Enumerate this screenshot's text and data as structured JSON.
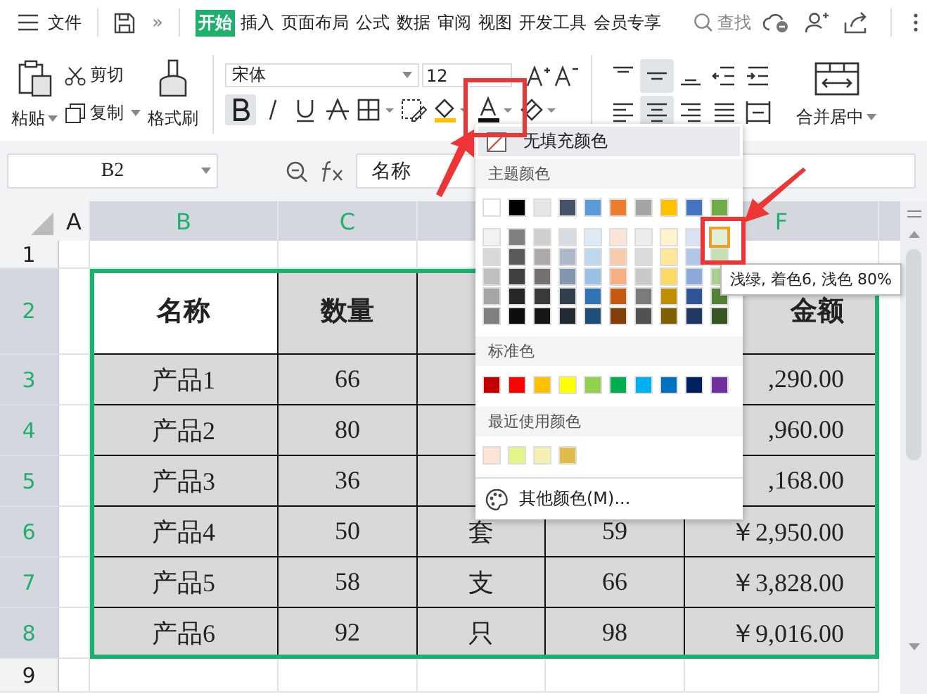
{
  "menu": {
    "file": "文件",
    "more": "»",
    "tabs": [
      {
        "label": "开始",
        "selected": true
      },
      {
        "label": "插入",
        "selected": false
      },
      {
        "label": "页面布局",
        "selected": false
      },
      {
        "label": "公式",
        "selected": false
      },
      {
        "label": "数据",
        "selected": false
      },
      {
        "label": "审阅",
        "selected": false
      },
      {
        "label": "视图",
        "selected": false
      },
      {
        "label": "开发工具",
        "selected": false
      },
      {
        "label": "会员专享",
        "selected": false
      }
    ],
    "search": "查找"
  },
  "ribbon": {
    "paste": "粘贴",
    "cut": "剪切",
    "copy": "复制",
    "format_painter": "格式刷",
    "font_name": "宋体",
    "font_size": "12",
    "bold": {
      "on": true
    },
    "italic": {
      "on": false
    },
    "underline": {
      "on": false
    },
    "align_rows": [
      [
        {
          "kind": "top",
          "selected": false
        },
        {
          "kind": "middle",
          "selected": true
        },
        {
          "kind": "bottom",
          "selected": false
        },
        {
          "kind": "outdent",
          "selected": false
        },
        {
          "kind": "indent",
          "selected": false
        }
      ],
      [
        {
          "kind": "left",
          "selected": false
        },
        {
          "kind": "center",
          "selected": true
        },
        {
          "kind": "right",
          "selected": false
        },
        {
          "kind": "justify",
          "selected": false
        },
        {
          "kind": "distribute",
          "selected": false
        }
      ]
    ],
    "merge": "合并居中"
  },
  "formula_bar": {
    "name_box": "B2",
    "formula": "名称"
  },
  "sheet": {
    "columns": [
      {
        "label": "A",
        "selected": false
      },
      {
        "label": "B",
        "selected": true
      },
      {
        "label": "C",
        "selected": true
      },
      {},
      {},
      {
        "label": "F",
        "selected": true
      }
    ],
    "rows": [
      {
        "label": "1",
        "selected": false,
        "kind": "blank"
      },
      {
        "label": "2",
        "selected": true,
        "kind": "header",
        "cells": [
          {},
          {
            "text": "名称",
            "active": true
          },
          {
            "text": "数量",
            "active": false
          },
          {},
          {},
          {
            "text": "金额",
            "active": false
          }
        ]
      },
      {
        "label": "3",
        "selected": true,
        "kind": "data",
        "cells": [
          {},
          {
            "text": "产品1",
            "active": false
          },
          {
            "text": "66",
            "active": false
          },
          {},
          {},
          {
            "text": ",290.00",
            "active": false
          }
        ]
      },
      {
        "label": "4",
        "selected": true,
        "kind": "data",
        "cells": [
          {},
          {
            "text": "产品2",
            "active": false
          },
          {
            "text": "80",
            "active": false
          },
          {},
          {},
          {
            "text": ",960.00",
            "active": false
          }
        ]
      },
      {
        "label": "5",
        "selected": true,
        "kind": "data",
        "cells": [
          {},
          {
            "text": "产品3",
            "active": false
          },
          {
            "text": "36",
            "active": false
          },
          {},
          {},
          {
            "text": ",168.00",
            "active": false
          }
        ]
      },
      {
        "label": "6",
        "selected": true,
        "kind": "data",
        "cells": [
          {},
          {
            "text": "产品4",
            "active": false
          },
          {
            "text": "50",
            "active": false
          },
          {
            "text": "套",
            "active": false
          },
          {
            "text": "59",
            "active": false
          },
          {
            "text": "￥2,950.00",
            "active": false
          }
        ]
      },
      {
        "label": "7",
        "selected": true,
        "kind": "data",
        "cells": [
          {},
          {
            "text": "产品5",
            "active": false
          },
          {
            "text": "58",
            "active": false
          },
          {
            "text": "支",
            "active": false
          },
          {
            "text": "66",
            "active": false
          },
          {
            "text": "￥3,828.00",
            "active": false
          }
        ]
      },
      {
        "label": "8",
        "selected": true,
        "kind": "data",
        "cells": [
          {},
          {
            "text": "产品6",
            "active": false
          },
          {
            "text": "92",
            "active": false
          },
          {
            "text": "只",
            "active": false
          },
          {
            "text": "98",
            "active": false
          },
          {
            "text": "￥9,016.00",
            "active": false
          }
        ]
      },
      {
        "label": "9",
        "selected": false,
        "kind": "blank"
      }
    ]
  },
  "fill_menu": {
    "no_fill": {
      "label": "无填充颜色",
      "highlighted": true
    },
    "theme_label": "主题颜色",
    "theme_colors": [
      {
        "color": "#ffffff",
        "selected": false,
        "shades": [
          {
            "color": "#f2f2f2",
            "selected": false
          },
          {
            "color": "#d9d9d9",
            "selected": false
          },
          {
            "color": "#bfbfbf",
            "selected": false
          },
          {
            "color": "#a6a6a6",
            "selected": false
          },
          {
            "color": "#808080",
            "selected": false
          }
        ]
      },
      {
        "color": "#000000",
        "selected": false,
        "shades": [
          {
            "color": "#808080",
            "selected": false
          },
          {
            "color": "#595959",
            "selected": false
          },
          {
            "color": "#404040",
            "selected": false
          },
          {
            "color": "#262626",
            "selected": false
          },
          {
            "color": "#0d0d0d",
            "selected": false
          }
        ]
      },
      {
        "color": "#e7e6e6",
        "selected": false,
        "shades": [
          {
            "color": "#d0cece",
            "selected": false
          },
          {
            "color": "#aeaaaa",
            "selected": false
          },
          {
            "color": "#757171",
            "selected": false
          },
          {
            "color": "#3a3838",
            "selected": false
          },
          {
            "color": "#171616",
            "selected": false
          }
        ]
      },
      {
        "color": "#44546a",
        "selected": false,
        "shades": [
          {
            "color": "#d6dce4",
            "selected": false
          },
          {
            "color": "#adb9ca",
            "selected": false
          },
          {
            "color": "#8497b0",
            "selected": false
          },
          {
            "color": "#333f4f",
            "selected": false
          },
          {
            "color": "#222b35",
            "selected": false
          }
        ]
      },
      {
        "color": "#5b9bd5",
        "selected": false,
        "shades": [
          {
            "color": "#ddebf7",
            "selected": false
          },
          {
            "color": "#bdd7ee",
            "selected": false
          },
          {
            "color": "#9bc2e6",
            "selected": false
          },
          {
            "color": "#2f75b5",
            "selected": false
          },
          {
            "color": "#1f4e78",
            "selected": false
          }
        ]
      },
      {
        "color": "#ed7d31",
        "selected": false,
        "shades": [
          {
            "color": "#fce4d6",
            "selected": false
          },
          {
            "color": "#f8cbad",
            "selected": false
          },
          {
            "color": "#f4b084",
            "selected": false
          },
          {
            "color": "#c65911",
            "selected": false
          },
          {
            "color": "#833c0c",
            "selected": false
          }
        ]
      },
      {
        "color": "#a5a5a5",
        "selected": false,
        "shades": [
          {
            "color": "#ededed",
            "selected": false
          },
          {
            "color": "#dbdbdb",
            "selected": false
          },
          {
            "color": "#c9c9c9",
            "selected": false
          },
          {
            "color": "#7b7b7b",
            "selected": false
          },
          {
            "color": "#525252",
            "selected": false
          }
        ]
      },
      {
        "color": "#ffc000",
        "selected": false,
        "shades": [
          {
            "color": "#fff2cc",
            "selected": false
          },
          {
            "color": "#ffe699",
            "selected": false
          },
          {
            "color": "#ffd966",
            "selected": false
          },
          {
            "color": "#bf8f00",
            "selected": false
          },
          {
            "color": "#806000",
            "selected": false
          }
        ]
      },
      {
        "color": "#4472c4",
        "selected": false,
        "shades": [
          {
            "color": "#d9e1f2",
            "selected": false
          },
          {
            "color": "#b4c6e7",
            "selected": false
          },
          {
            "color": "#8ea9db",
            "selected": false
          },
          {
            "color": "#305496",
            "selected": false
          },
          {
            "color": "#203764",
            "selected": false
          }
        ]
      },
      {
        "color": "#70ad47",
        "selected": false,
        "shades": [
          {
            "color": "#e2efda",
            "selected": true
          },
          {
            "color": "#c6e0b4",
            "selected": false
          },
          {
            "color": "#a9d08e",
            "selected": false
          },
          {
            "color": "#548235",
            "selected": false
          },
          {
            "color": "#375623",
            "selected": false
          }
        ]
      }
    ],
    "standard_label": "标准色",
    "standard_colors": [
      {
        "color": "#c00000",
        "selected": false
      },
      {
        "color": "#ff0000",
        "selected": false
      },
      {
        "color": "#ffc000",
        "selected": false
      },
      {
        "color": "#ffff00",
        "selected": false
      },
      {
        "color": "#92d050",
        "selected": false
      },
      {
        "color": "#00b050",
        "selected": false
      },
      {
        "color": "#00b0f0",
        "selected": false
      },
      {
        "color": "#0070c0",
        "selected": false
      },
      {
        "color": "#002060",
        "selected": false
      },
      {
        "color": "#7030a0",
        "selected": false
      }
    ],
    "recent_label": "最近使用颜色",
    "recent_colors": [
      {
        "color": "#fce4d6",
        "selected": false
      },
      {
        "color": "#e4f58a",
        "selected": false
      },
      {
        "color": "#f7f0b4",
        "selected": false
      },
      {
        "color": "#e0bc4a",
        "selected": false
      }
    ],
    "more": "其他颜色(M)..."
  },
  "tooltip": "浅绿, 着色6, 浅色 80%"
}
